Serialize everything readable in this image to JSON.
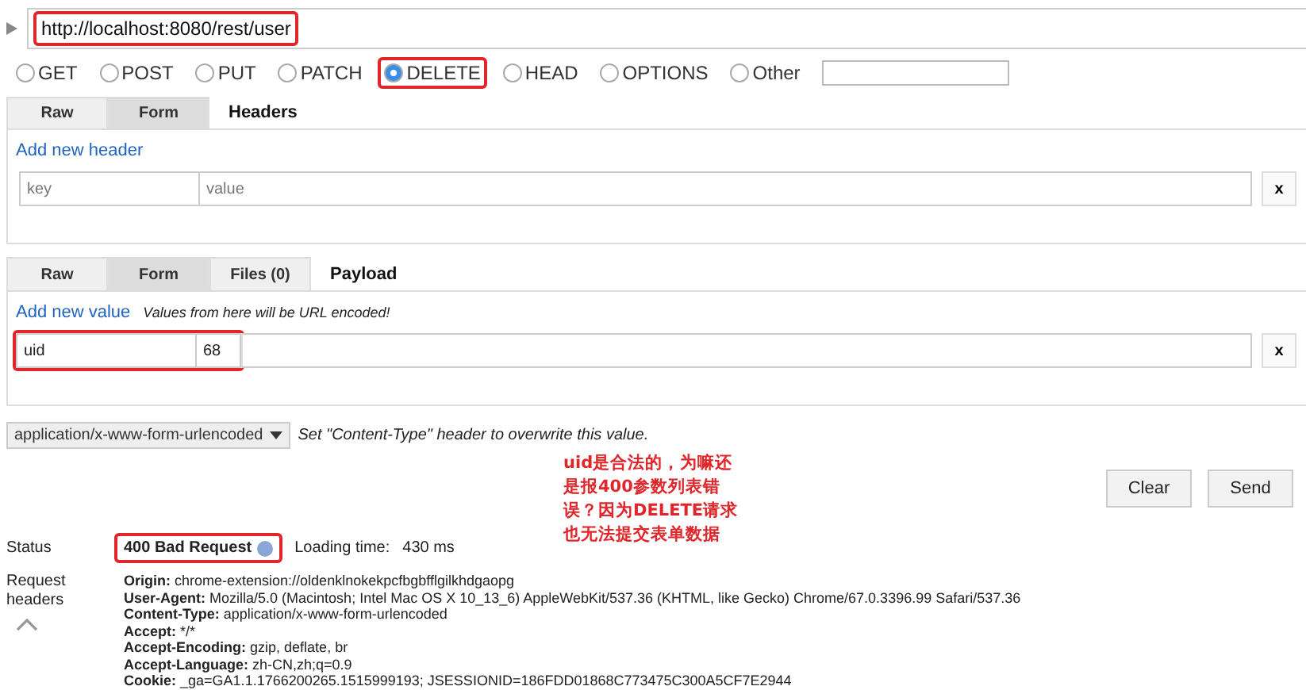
{
  "url": {
    "value": "http://localhost:8080/rest/user",
    "highlighted": true
  },
  "methods": [
    {
      "label": "GET",
      "selected": false,
      "highlighted": false
    },
    {
      "label": "POST",
      "selected": false,
      "highlighted": false
    },
    {
      "label": "PUT",
      "selected": false,
      "highlighted": false
    },
    {
      "label": "PATCH",
      "selected": false,
      "highlighted": false
    },
    {
      "label": "DELETE",
      "selected": true,
      "highlighted": true
    },
    {
      "label": "HEAD",
      "selected": false,
      "highlighted": false
    },
    {
      "label": "OPTIONS",
      "selected": false,
      "highlighted": false
    },
    {
      "label": "Other",
      "selected": false,
      "highlighted": false
    }
  ],
  "headers": {
    "tabs": [
      {
        "label": "Raw",
        "selected": false
      },
      {
        "label": "Form",
        "selected": true
      }
    ],
    "title": "Headers",
    "add_link": "Add new header",
    "rows": [
      {
        "key_placeholder": "key",
        "value_placeholder": "value",
        "remove": "x",
        "highlighted": false
      }
    ]
  },
  "payload": {
    "tabs": [
      {
        "label": "Raw",
        "selected": false
      },
      {
        "label": "Form",
        "selected": true
      },
      {
        "label": "Files (0)",
        "selected": false
      }
    ],
    "title": "Payload",
    "add_link": "Add new value",
    "note": "Values from here will be URL encoded!",
    "rows": [
      {
        "key": "uid",
        "value": "68",
        "remove": "x",
        "highlighted": true
      }
    ]
  },
  "content_type": {
    "value": "application/x-www-form-urlencoded",
    "note": "Set \"Content-Type\" header to overwrite this value."
  },
  "annotation": "uid是合法的，为嘛还是报400参数列表错误？因为DELETE请求也无法提交表单数据",
  "buttons": [
    "Clear",
    "Send"
  ],
  "status": {
    "label": "Status",
    "value": "400 Bad Request",
    "highlighted": true,
    "loading_label": "Loading time:",
    "loading_value": "430 ms"
  },
  "request_headers": {
    "label": "Request headers",
    "entries": [
      {
        "name": "Origin:",
        "value": "chrome-extension://oldenklnokekpcfbgbfflgilkhdgaopg"
      },
      {
        "name": "User-Agent:",
        "value": "Mozilla/5.0 (Macintosh; Intel Mac OS X 10_13_6) AppleWebKit/537.36 (KHTML, like Gecko) Chrome/67.0.3396.99 Safari/537.36"
      },
      {
        "name": "Content-Type:",
        "value": "application/x-www-form-urlencoded"
      },
      {
        "name": "Accept:",
        "value": "*/*"
      },
      {
        "name": "Accept-Encoding:",
        "value": "gzip, deflate, br"
      },
      {
        "name": "Accept-Language:",
        "value": "zh-CN,zh;q=0.9"
      },
      {
        "name": "Cookie:",
        "value": "_ga=GA1.1.1766200265.1515999193; JSESSIONID=186FDD01868C773475C300A5CF7E2944"
      }
    ]
  }
}
